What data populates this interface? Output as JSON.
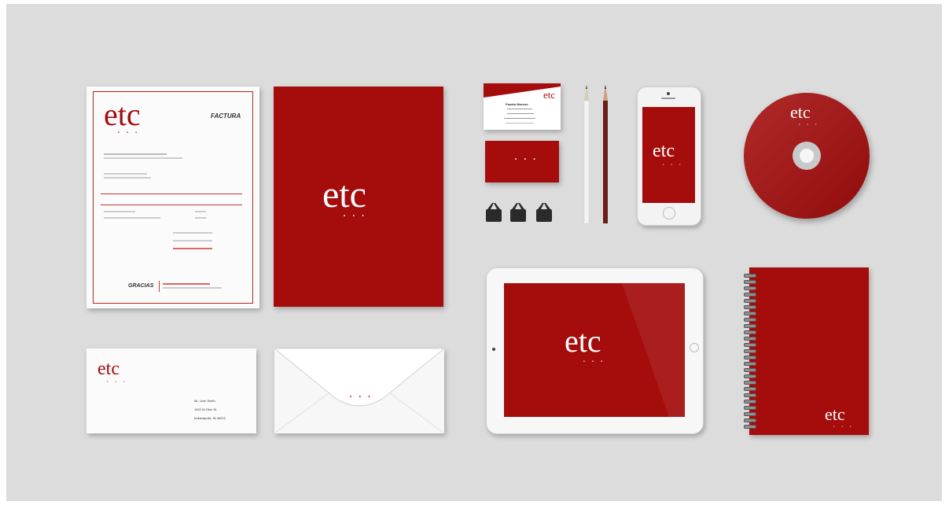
{
  "brand": {
    "logo": "etc",
    "dots": "• • •",
    "primary_color": "#a50d0d",
    "background_color": "#dcdcdc"
  },
  "invoice": {
    "title": "FACTURA",
    "thanks": "GRACIAS"
  },
  "envelope": {
    "address_line1": "Mr. John Smith",
    "address_line2": "1820 W Ohio St",
    "address_line3": "Indianapolis, IN 46222"
  },
  "business_card": {
    "name": "Fausto Moreno"
  }
}
